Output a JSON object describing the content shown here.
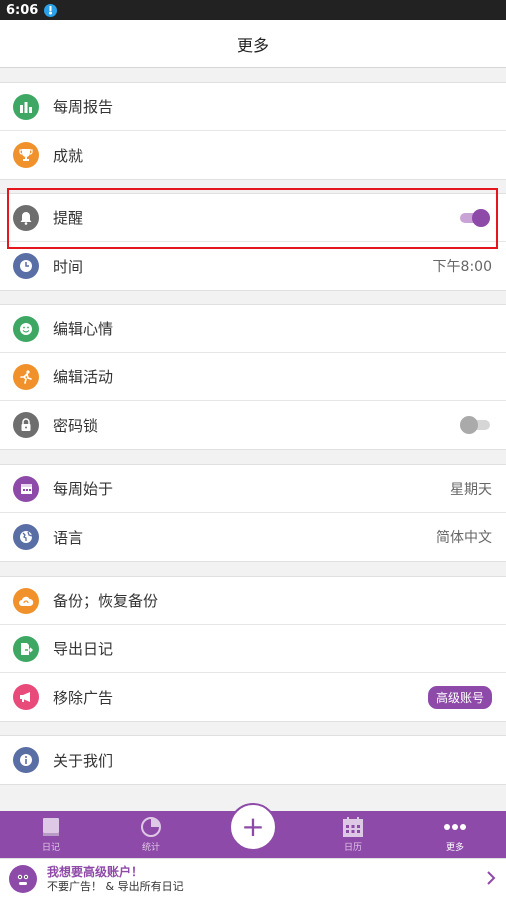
{
  "status_bar": {
    "time": "6:06"
  },
  "header": {
    "title": "更多"
  },
  "sections": [
    {
      "items": [
        {
          "label": "每周报告",
          "icon": "bar-chart-icon",
          "color": "#3ea764"
        },
        {
          "label": "成就",
          "icon": "trophy-icon",
          "color": "#f0912c"
        }
      ]
    },
    {
      "items": [
        {
          "label": "提醒",
          "icon": "bell-icon",
          "color": "#6e6e6e",
          "toggle": "on"
        },
        {
          "label": "时间",
          "icon": "clock-icon",
          "color": "#5a6ea6",
          "value": "下午8:00"
        }
      ]
    },
    {
      "items": [
        {
          "label": "编辑心情",
          "icon": "smiley-icon",
          "color": "#3ea764"
        },
        {
          "label": "编辑活动",
          "icon": "runner-icon",
          "color": "#f0912c"
        },
        {
          "label": "密码锁",
          "icon": "lock-icon",
          "color": "#6e6e6e",
          "toggle": "off"
        }
      ]
    },
    {
      "items": [
        {
          "label": "每周始于",
          "icon": "calendar-icon",
          "color": "#8e4aa8",
          "value": "星期天"
        },
        {
          "label": "语言",
          "icon": "globe-icon",
          "color": "#5a6ea6",
          "value": "简体中文"
        }
      ]
    },
    {
      "items": [
        {
          "label": "备份；恢复备份",
          "icon": "cloud-backup-icon",
          "color": "#f0912c"
        },
        {
          "label": "导出日记",
          "icon": "export-icon",
          "color": "#3ea764"
        },
        {
          "label": "移除广告",
          "icon": "megaphone-icon",
          "color": "#e84a7a",
          "badge": "高级账号"
        }
      ]
    },
    {
      "items": [
        {
          "label": "关于我们",
          "icon": "info-icon",
          "color": "#5a6ea6"
        }
      ]
    }
  ],
  "tabbar": {
    "tabs": [
      {
        "label": "日记",
        "icon": "diary-icon"
      },
      {
        "label": "统计",
        "icon": "stats-icon"
      },
      {
        "label": "日历",
        "icon": "calendar-tab-icon"
      },
      {
        "label": "更多",
        "icon": "more-icon",
        "active": true
      }
    ],
    "add_label": "+"
  },
  "promo": {
    "title": "我想要高级账户！",
    "subtitle": "不要广告！ & 导出所有日记"
  },
  "colors": {
    "accent": "#8e4aa8",
    "highlight": "#e3171d"
  }
}
